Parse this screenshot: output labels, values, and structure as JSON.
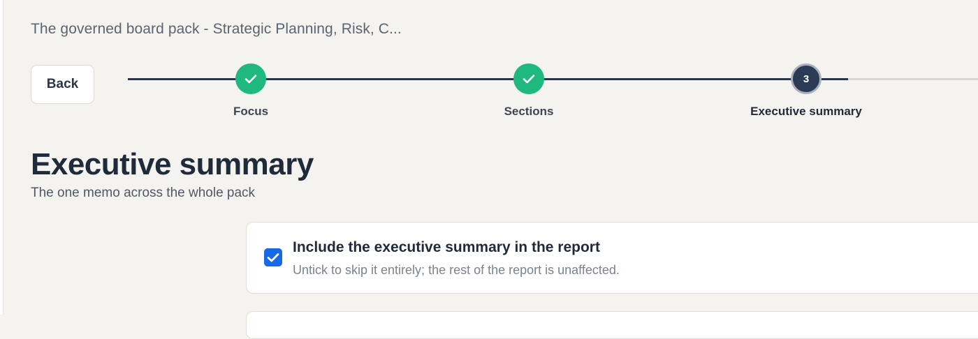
{
  "header": {
    "pack_title": "The governed board pack - Strategic Planning, Risk, C..."
  },
  "nav": {
    "back_label": "Back"
  },
  "stepper": {
    "steps": [
      {
        "label": "Focus",
        "status": "complete",
        "icon": "check-icon"
      },
      {
        "label": "Sections",
        "status": "complete",
        "icon": "check-icon"
      },
      {
        "label": "Executive summary",
        "status": "current",
        "number": "3"
      }
    ]
  },
  "section": {
    "heading": "Executive summary",
    "subtitle": "The one memo across the whole pack"
  },
  "include_option": {
    "label": "Include the executive summary in the report",
    "hint": "Untick to skip it entirely; the rest of the report is unaffected.",
    "checked": true
  },
  "colors": {
    "complete": "#1fb97f",
    "current": "#2b3a55",
    "checkbox": "#1769e6",
    "track_done": "#2b3547",
    "track_todo": "#d9d6cf",
    "background": "#f4f3ef"
  }
}
